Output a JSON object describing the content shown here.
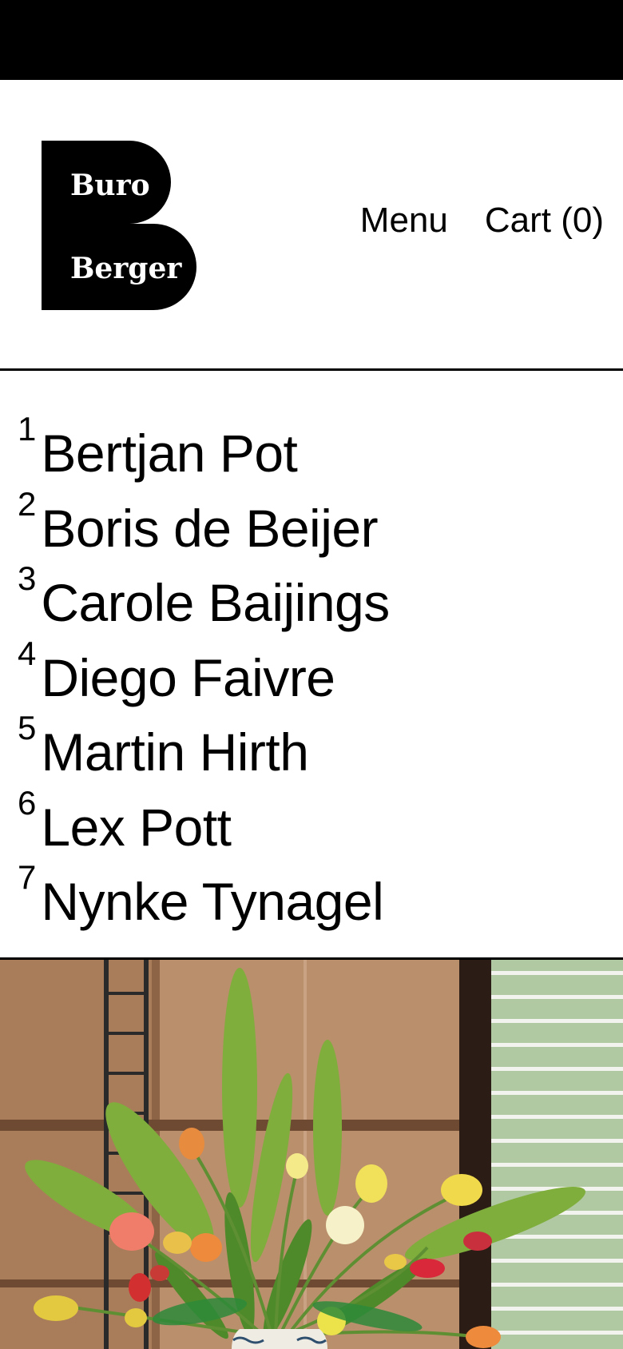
{
  "logo": {
    "line1": "Buro",
    "line2": "Berger"
  },
  "nav": {
    "menu": "Menu",
    "cart": "Cart (0)"
  },
  "designers": [
    {
      "num": "1",
      "name": "Bertjan Pot"
    },
    {
      "num": "2",
      "name": "Boris de Beijer"
    },
    {
      "num": "3",
      "name": "Carole Baijings"
    },
    {
      "num": "4",
      "name": "Diego Faivre"
    },
    {
      "num": "5",
      "name": "Martin Hirth"
    },
    {
      "num": "6",
      "name": "Lex Pott"
    },
    {
      "num": "7",
      "name": "Nynke Tynagel"
    }
  ],
  "colors": {
    "background": "#ffffff",
    "text": "#000000",
    "statusbar": "#000000"
  }
}
